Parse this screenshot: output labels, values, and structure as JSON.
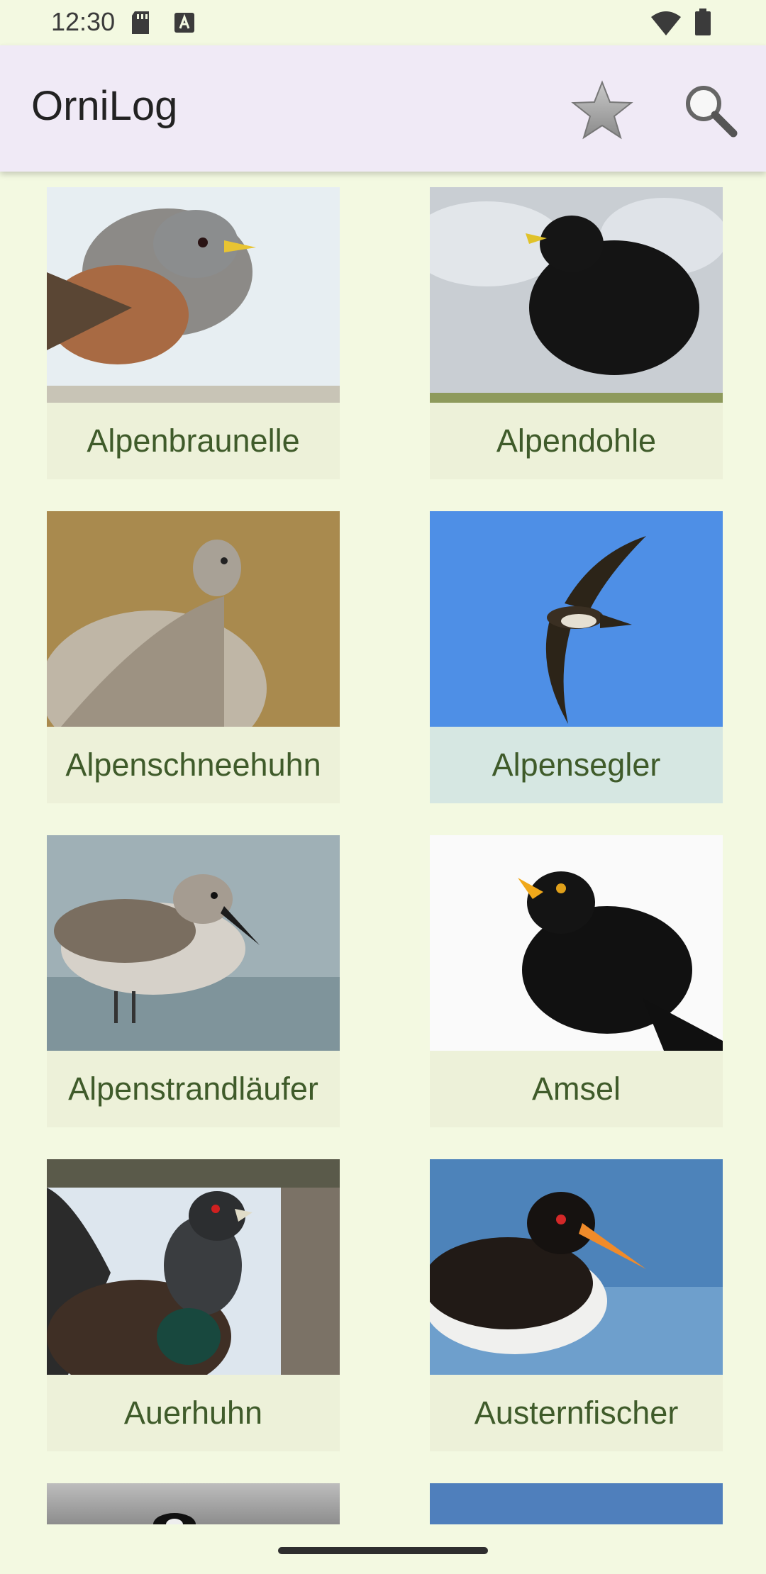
{
  "status_bar": {
    "time": "12:30",
    "icons": [
      "sd-card-icon",
      "font-a-icon",
      "wifi-icon",
      "battery-icon"
    ]
  },
  "app_bar": {
    "title": "OrniLog",
    "actions": [
      "star-icon",
      "search-icon"
    ]
  },
  "birds": [
    {
      "name": "Alpenbraunelle"
    },
    {
      "name": "Alpendohle"
    },
    {
      "name": "Alpenschneehuhn"
    },
    {
      "name": "Alpensegler"
    },
    {
      "name": "Alpenstrandläufer"
    },
    {
      "name": "Amsel"
    },
    {
      "name": "Auerhuhn"
    },
    {
      "name": "Austernfischer"
    }
  ],
  "colors": {
    "background": "#f3f9e1",
    "app_bar": "#f0eaf6",
    "label_text": "#3f5b2a"
  }
}
